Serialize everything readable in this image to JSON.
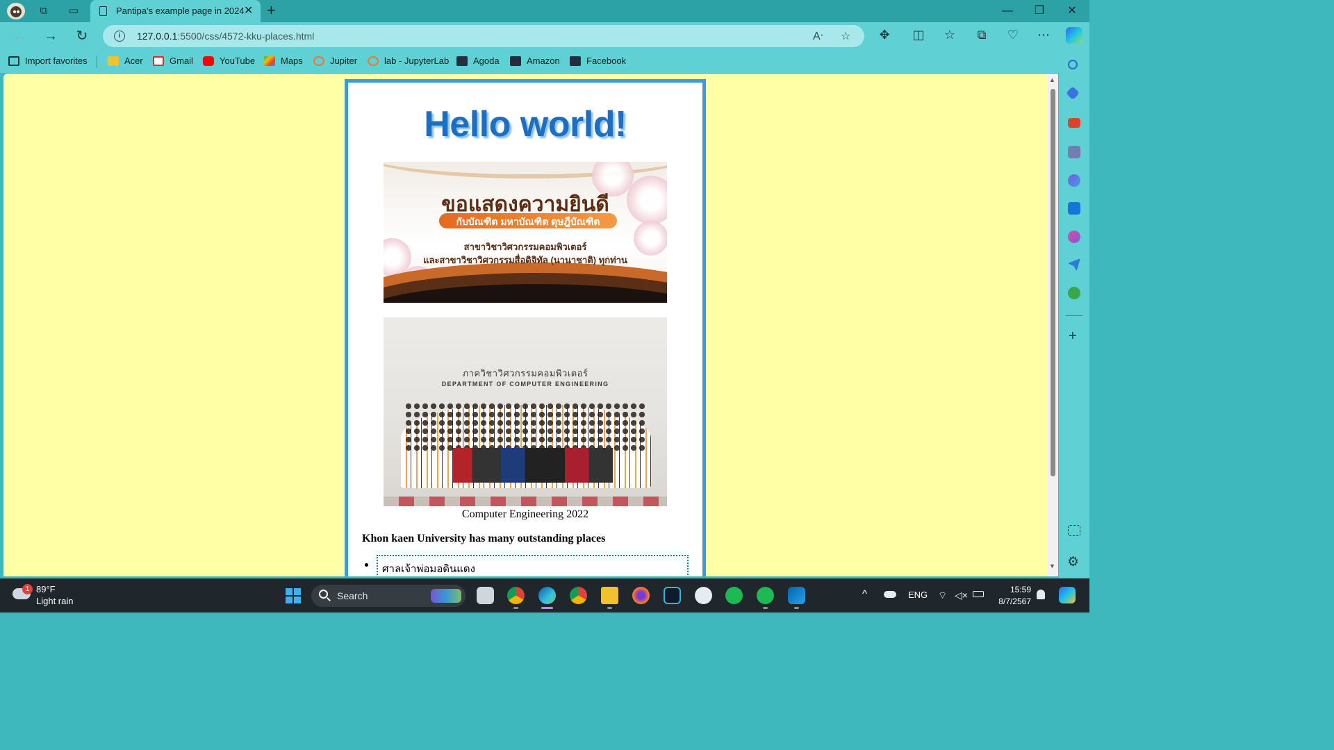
{
  "browser": {
    "tab_title": "Pantipa's example page in 2024",
    "url_host": "127.0.0.1",
    "url_rest": ":5500/css/4572-kku-places.html",
    "favorites": [
      {
        "label": "Import favorites",
        "icon": "import-icon",
        "color": "#17393a"
      },
      {
        "label": "Acer",
        "icon": "folder-icon",
        "color": "#f2c12e"
      },
      {
        "label": "Gmail",
        "icon": "gmail-icon",
        "color": "#d93025"
      },
      {
        "label": "YouTube",
        "icon": "youtube-icon",
        "color": "#ff0000"
      },
      {
        "label": "Maps",
        "icon": "maps-icon",
        "color": "#34a853"
      },
      {
        "label": "Jupiter",
        "icon": "jupyter-icon",
        "color": "#f37726"
      },
      {
        "label": "lab - JupyterLab",
        "icon": "jupyter-icon",
        "color": "#f37726"
      },
      {
        "label": "Agoda",
        "icon": "aws-icon",
        "color": "#232f3e"
      },
      {
        "label": "Amazon",
        "icon": "aws-icon",
        "color": "#232f3e"
      },
      {
        "label": "Facebook",
        "icon": "aws-icon",
        "color": "#232f3e"
      }
    ]
  },
  "page": {
    "background": "#ffffa6",
    "heading": "Hello world!",
    "banner": {
      "line1": "ขอแสดงความยินดี",
      "line2": "กับบัณฑิต มหาบัณฑิต ดุษฎีบัณฑิต",
      "line3": "สาขาวิชาวิศวกรรมคอมพิวเตอร์",
      "line4": "และสาขาวิชาวิศวกรรมสื่อดิจิทัล (นานาชาติ) ทุกท่าน"
    },
    "photo": {
      "sign_thai": "ภาควิชาวิศวกรรมคอมพิวเตอร์",
      "sign_english": "DEPARTMENT OF COMPUTER ENGINEERING"
    },
    "caption": "Computer Engineering 2022",
    "subheading": "Khon kaen University has many outstanding places",
    "places": [
      "ศาลเจ้าพ่อมอดินแดง"
    ]
  },
  "taskbar": {
    "weather_badge": "1",
    "temperature": "89°F",
    "weather": "Light rain",
    "search_label": "Search",
    "language": "ENG",
    "time": "15:59",
    "date": "8/7/2567"
  }
}
